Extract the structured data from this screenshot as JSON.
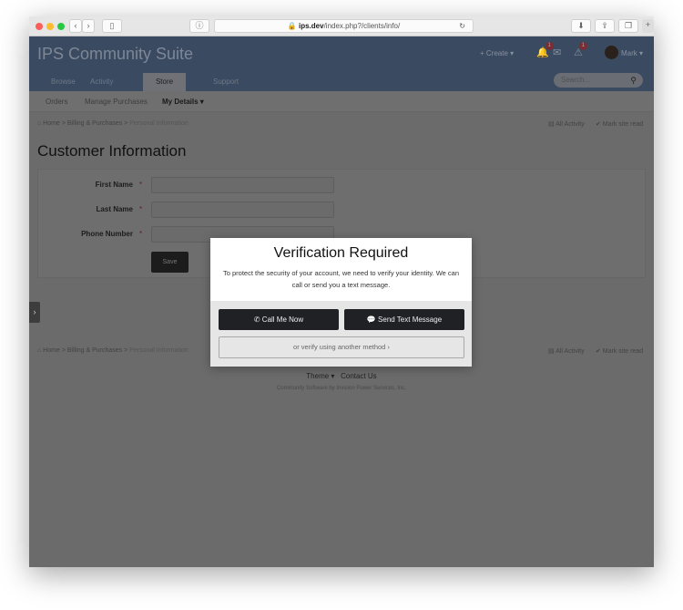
{
  "browser": {
    "url_domain": "ips.dev",
    "url_path": "/index.php?/clients/info/"
  },
  "header": {
    "site_title": "IPS Community Suite",
    "create_label": "+ Create ▾",
    "notif_count": "1",
    "alert_count": "1",
    "user_name": "Mark ▾"
  },
  "nav": {
    "tabs": [
      {
        "label": "Browse"
      },
      {
        "label": "Activity"
      },
      {
        "label": "Store"
      },
      {
        "label": "Support"
      }
    ],
    "search_placeholder": "Search..."
  },
  "subnav": {
    "items": [
      {
        "label": "Orders"
      },
      {
        "label": "Manage Purchases"
      },
      {
        "label": "My Details ▾"
      }
    ]
  },
  "breadcrumb": {
    "home": "⌂ Home",
    "sep": ">",
    "billing": "Billing & Purchases",
    "current": "Personal Information",
    "all_activity": "All Activity",
    "mark_read": "✔ Mark site read"
  },
  "page": {
    "title": "Customer Information"
  },
  "form": {
    "fields": [
      {
        "label": "First Name",
        "value": ""
      },
      {
        "label": "Last Name",
        "value": ""
      },
      {
        "label": "Phone Number",
        "value": ""
      }
    ],
    "required_mark": "*",
    "save_label": "Save"
  },
  "footer": {
    "theme": "Theme ▾",
    "contact": "Contact Us",
    "copyright": "Community Software by Invision Power Services, Inc."
  },
  "modal": {
    "title": "Verification Required",
    "text": "To protect the security of your account, we need to verify your identity. We can call or send you a text message.",
    "call_label": "Call Me Now",
    "sms_label": "Send Text Message",
    "other_label": "or verify using another method ›"
  }
}
